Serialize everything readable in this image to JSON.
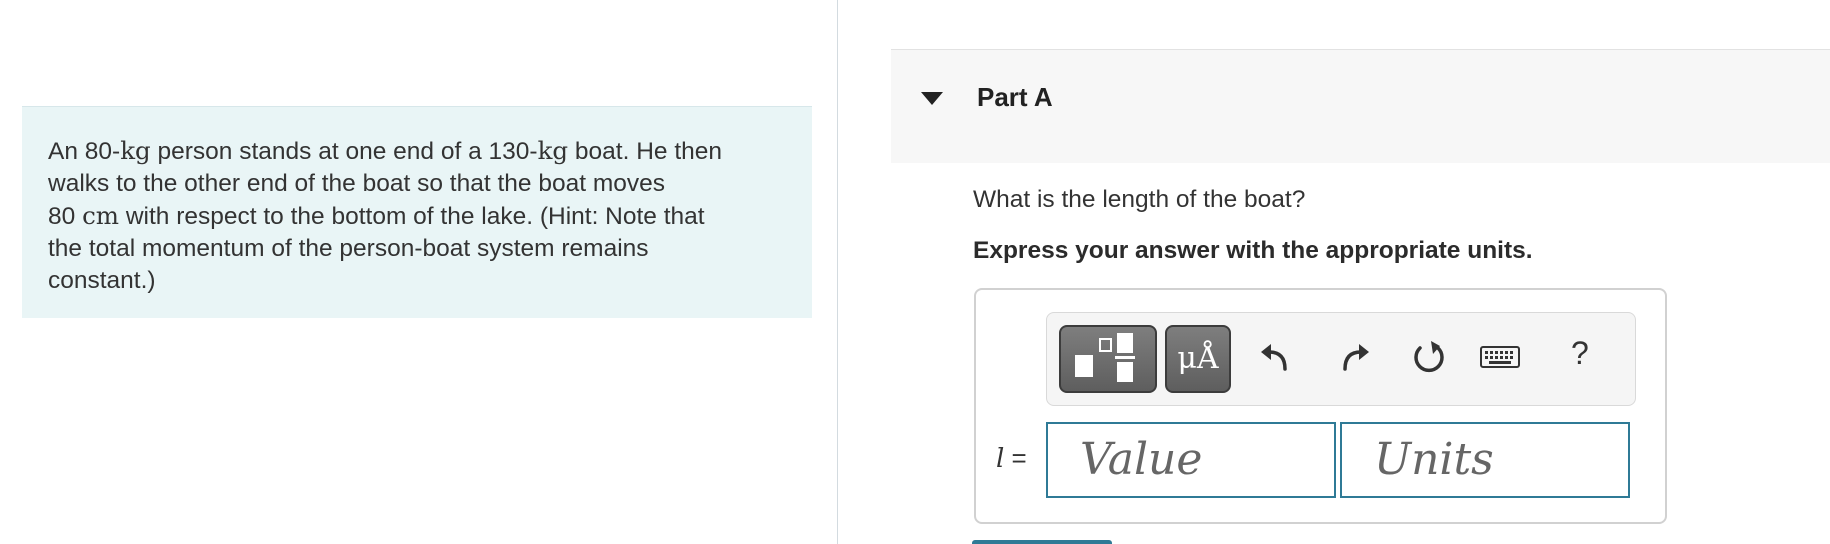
{
  "problem": {
    "parts": [
      {
        "text": "An 80-"
      },
      {
        "text": "kg",
        "serif": true
      },
      {
        "text": " person stands at one end of a 130-"
      },
      {
        "text": "kg",
        "serif": true
      },
      {
        "text": " boat. He then"
      },
      {
        "br": true
      },
      {
        "text": "walks to the other end of the boat so that the boat moves"
      },
      {
        "br": true
      },
      {
        "text": "80 "
      },
      {
        "text": "cm",
        "serif": true
      },
      {
        "text": " with respect to the bottom of the lake. (Hint: Note that"
      },
      {
        "br": true
      },
      {
        "text": "the total momentum of the person-boat system remains"
      },
      {
        "br": true
      },
      {
        "text": "constant.)"
      }
    ]
  },
  "part": {
    "title": "Part A",
    "question": "What is the length of the boat?",
    "instruction": "Express your answer with the appropriate units."
  },
  "toolbar": {
    "units_label": "μÅ",
    "help_label": "?",
    "icons": [
      "fraction-template-icon",
      "undo-icon",
      "redo-icon",
      "reset-icon",
      "keyboard-icon"
    ]
  },
  "answer": {
    "variable": "l",
    "equals": " =",
    "value_placeholder": "Value",
    "units_placeholder": "Units"
  },
  "colors": {
    "problem_bg": "#e9f5f6",
    "field_border": "#2f7a96",
    "toolbar_button": "#6b6b6b"
  }
}
